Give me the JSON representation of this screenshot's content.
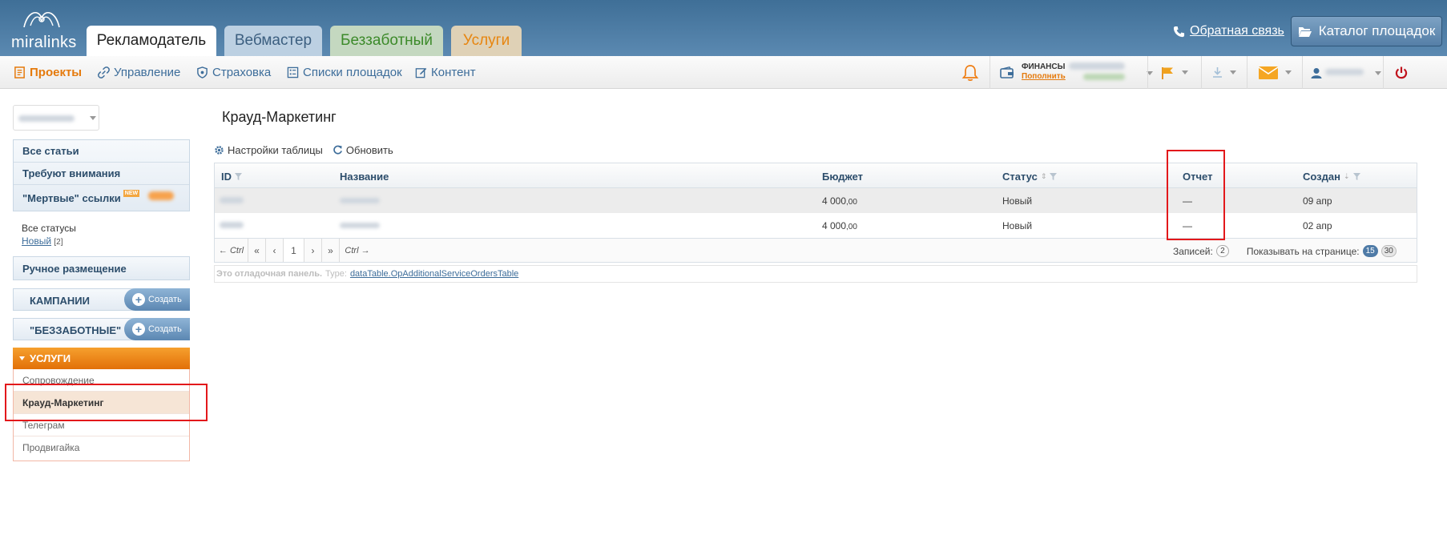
{
  "brand": {
    "name": "miralinks"
  },
  "tabs": [
    {
      "label": "Рекламодатель"
    },
    {
      "label": "Вебмастер"
    },
    {
      "label": "Беззаботный"
    },
    {
      "label": "Услуги"
    }
  ],
  "header": {
    "feedback_label": "Обратная связь",
    "catalog_label": "Каталог площадок"
  },
  "subnav": [
    {
      "label": "Проекты",
      "icon": "projects-icon"
    },
    {
      "label": "Управление",
      "icon": "link-icon"
    },
    {
      "label": "Страховка",
      "icon": "shield-icon"
    },
    {
      "label": "Списки площадок",
      "icon": "list-icon"
    },
    {
      "label": "Контент",
      "icon": "edit-icon"
    }
  ],
  "toolbar": {
    "finance_label": "ФИНАНСЫ",
    "topup_label": "Пополнить"
  },
  "sidebar": {
    "filters": [
      {
        "label": "Все статьи"
      },
      {
        "label": "Требуют внимания"
      },
      {
        "label": "\"Мертвые\" ссылки",
        "badge": "NEW"
      }
    ],
    "statuses_title": "Все статусы",
    "status_new_label": "Новый",
    "status_new_count": "[2]",
    "manual_label": "Ручное размещение",
    "campaigns_label": "КАМПАНИИ",
    "carefree_label": "\"БЕЗЗАБОТНЫЕ\"",
    "create_label": "Создать",
    "services_title": "УСЛУГИ",
    "services": [
      {
        "label": "Сопровождение"
      },
      {
        "label": "Крауд-Маркетинг"
      },
      {
        "label": "Телеграм"
      },
      {
        "label": "Продвигайка"
      }
    ]
  },
  "main": {
    "title": "Крауд-Маркетинг",
    "table_settings_label": "Настройки таблицы",
    "refresh_label": "Обновить",
    "columns": {
      "id": "ID",
      "name": "Название",
      "budget": "Бюджет",
      "status": "Статус",
      "report": "Отчет",
      "created": "Создан"
    },
    "rows": [
      {
        "budget_int": "4 000",
        "budget_dec": ",00",
        "status": "Новый",
        "report": "—",
        "created": "09 апр"
      },
      {
        "budget_int": "4 000",
        "budget_dec": ",00",
        "status": "Новый",
        "report": "—",
        "created": "02 апр"
      }
    ],
    "pager": {
      "prev_ctrl": "← Ctrl",
      "first": "«",
      "prev": "‹",
      "page": "1",
      "next": "›",
      "last": "»",
      "next_ctrl": "Ctrl →",
      "records_label": "Записей:",
      "records_count": "2",
      "per_page_label": "Показывать на странице:",
      "per_page_options": [
        "15",
        "30"
      ]
    },
    "debug": {
      "title": "Это отладочная панель.",
      "type_label": "Type:",
      "type_value": "dataTable.OpAdditionalServiceOrdersTable"
    }
  },
  "colors": {
    "header_bg": "#4a7aa3",
    "accent_orange": "#e57a0c",
    "link_blue": "#3d6d9a",
    "highlight_red": "#e3181b"
  }
}
